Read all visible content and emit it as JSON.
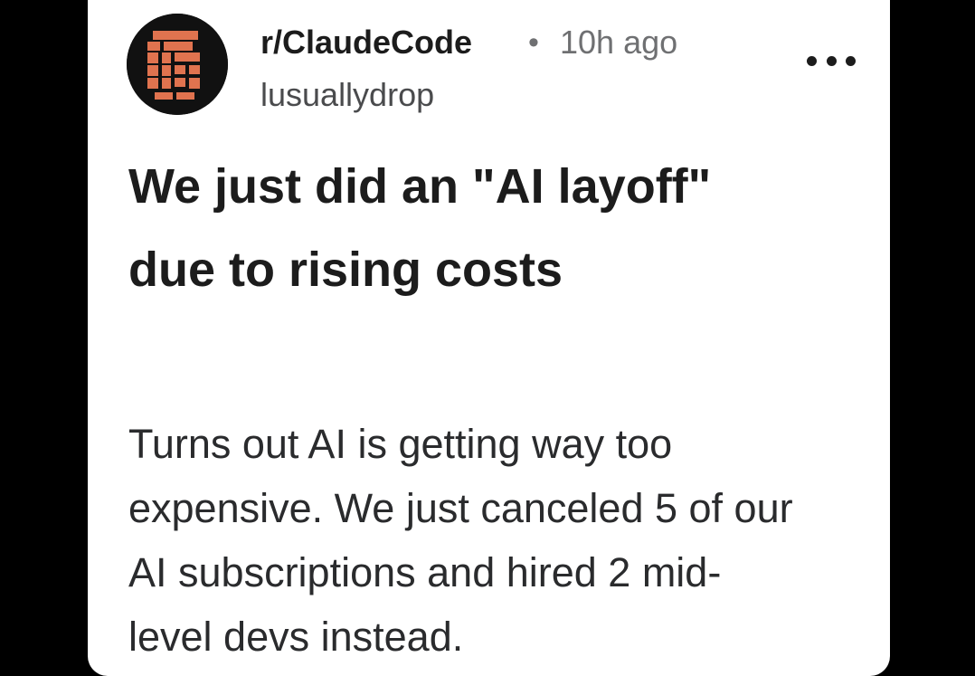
{
  "post": {
    "subreddit": "r/ClaudeCode",
    "separator": "•",
    "time_ago": "10h ago",
    "username": "lusuallydrop",
    "title_lines": [
      "We just did an \"AI layoff\"",
      "due to rising costs"
    ],
    "body_lines": [
      "Turns out AI is getting way too",
      "expensive. We just canceled 5 of our",
      "AI subscriptions and hired 2 mid-",
      "level devs instead."
    ],
    "more_icon": "more-horizontal-icon",
    "avatar_icon": "subreddit-avatar-icon"
  },
  "colors": {
    "background": "#000000",
    "card": "#ffffff",
    "text_primary": "#1c1c1c",
    "text_secondary": "#6f7072",
    "avatar_accent": "#e0734f"
  }
}
